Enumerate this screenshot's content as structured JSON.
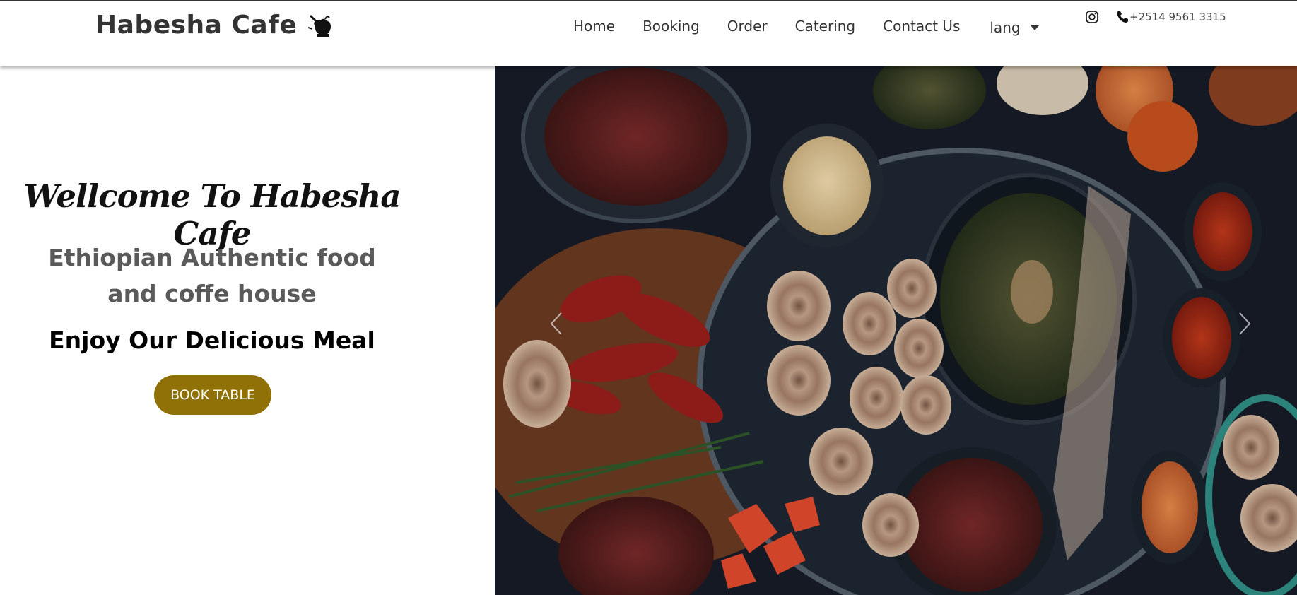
{
  "brand": {
    "name": "Habesha Cafe",
    "icon": "coffee-pot-icon"
  },
  "nav": {
    "items": [
      {
        "label": "Home"
      },
      {
        "label": "Booking"
      },
      {
        "label": "Order"
      },
      {
        "label": "Catering"
      },
      {
        "label": "Contact Us"
      }
    ],
    "lang_label": "lang",
    "instagram_icon": "instagram-icon",
    "phone_icon": "phone-icon",
    "phone": "+2514 9561 3315"
  },
  "hero": {
    "welcome": "Wellcome To Habesha Cafe",
    "subtitle": "Ethiopian Authentic food and coffe house",
    "tagline": "Enjoy Our Delicious Meal",
    "button_label": "BOOK TABLE",
    "button_color": "#8f7108"
  },
  "carousel": {
    "prev_icon": "chevron-left-icon",
    "next_icon": "chevron-right-icon",
    "image": "ethiopian-food-platter"
  }
}
